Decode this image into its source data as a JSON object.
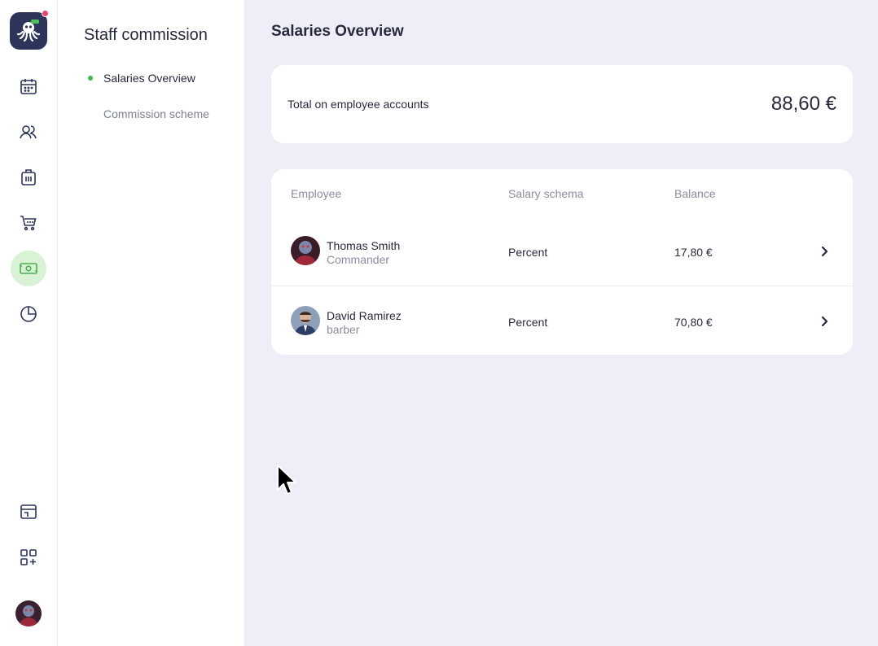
{
  "subnav": {
    "title": "Staff commission",
    "items": [
      {
        "label": "Salaries Overview",
        "active": true
      },
      {
        "label": "Commission scheme",
        "active": false
      }
    ]
  },
  "main": {
    "title": "Salaries Overview",
    "total": {
      "label": "Total on employee accounts",
      "value": "88,60 €"
    },
    "table": {
      "headers": [
        "Employee",
        "Salary schema",
        "Balance"
      ],
      "rows": [
        {
          "name": "Thomas Smith",
          "role": "Commander",
          "schema": "Percent",
          "balance": "17,80 €"
        },
        {
          "name": "David Ramirez",
          "role": "barber",
          "schema": "Percent",
          "balance": "70,80 €"
        }
      ]
    }
  },
  "colors": {
    "accent_green": "#3fb84a",
    "active_rail_bg": "#d9f2d6",
    "logo_bg": "#2c3559",
    "notification": "#e8456b",
    "main_bg": "#eeedf8"
  },
  "icons": {
    "rail": [
      "calendar-icon",
      "clients-icon",
      "services-icon",
      "cart-icon",
      "money-icon",
      "chart-icon",
      "window-icon",
      "apps-add-icon"
    ]
  }
}
